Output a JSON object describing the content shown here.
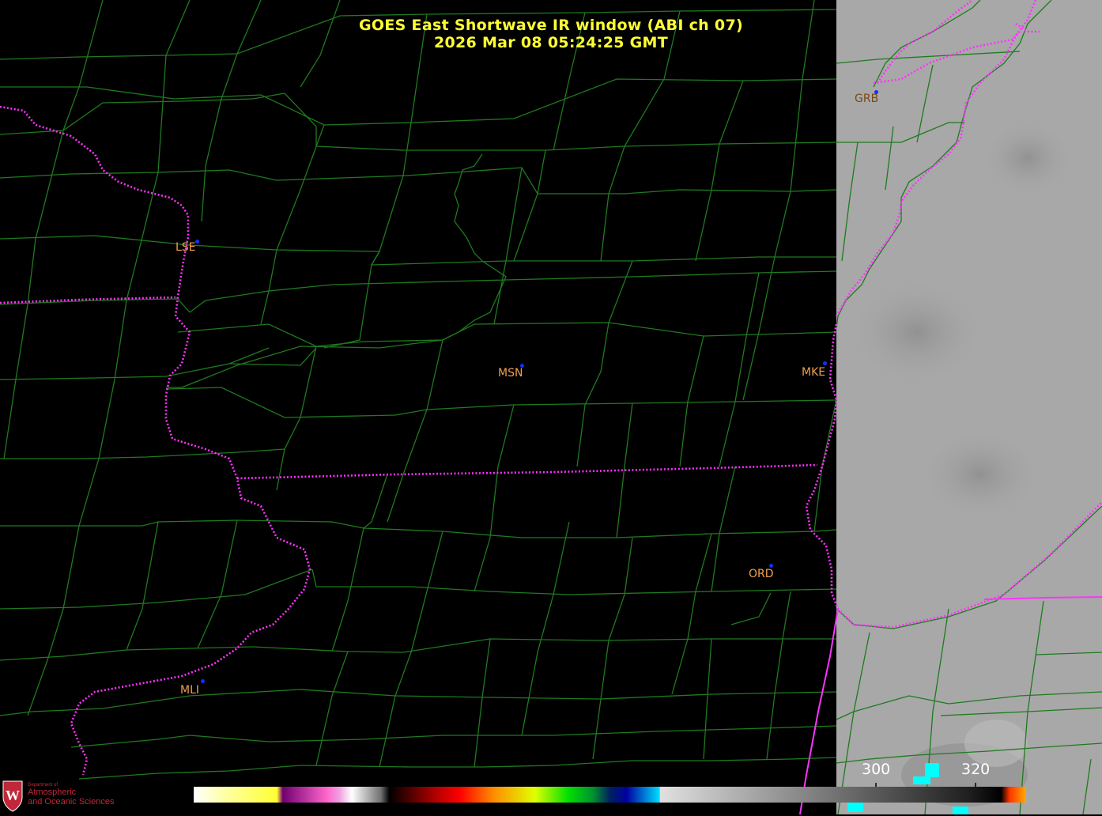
{
  "title_line1": "GOES East Shortwave IR window (ABI ch 07)",
  "title_line2": "2026 Mar 08  05:24:25 GMT",
  "cities": [
    {
      "id": "GRB",
      "label": "GRB"
    },
    {
      "id": "LSE",
      "label": "LSE"
    },
    {
      "id": "MSN",
      "label": "MSN"
    },
    {
      "id": "MKE",
      "label": "MKE"
    },
    {
      "id": "ORD",
      "label": "ORD"
    },
    {
      "id": "MLI",
      "label": "MLI"
    }
  ],
  "colorbar": {
    "tick_labels": [
      "300",
      "320"
    ]
  },
  "logo": {
    "line1": "Department of",
    "line2": "Atmospheric",
    "line3": "and Oceanic Sciences"
  },
  "colors": {
    "title": "#ffff33",
    "county_lines": "#1f7a1f",
    "state_border": "#ff33ff",
    "city_label": "#f0a050",
    "city_dot": "#1030ff",
    "lake_gray": "#a9a9a9"
  }
}
